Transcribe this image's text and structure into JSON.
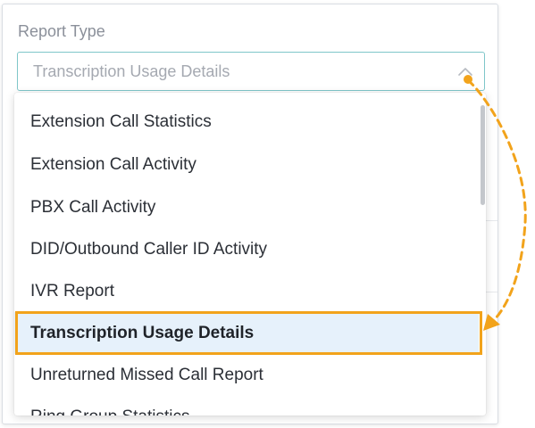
{
  "report_type": {
    "label": "Report Type",
    "selected_value": "Transcription Usage Details"
  },
  "dropdown": {
    "options": [
      {
        "label": "Extension Call Statistics",
        "selected": false
      },
      {
        "label": "Extension Call Activity",
        "selected": false
      },
      {
        "label": "PBX Call Activity",
        "selected": false
      },
      {
        "label": "DID/Outbound Caller ID Activity",
        "selected": false
      },
      {
        "label": "IVR Report",
        "selected": false
      },
      {
        "label": "Transcription Usage Details",
        "selected": true
      },
      {
        "label": "Unreturned Missed Call Report",
        "selected": false
      },
      {
        "label": "Ring Group Statistics",
        "selected": false
      }
    ]
  },
  "colors": {
    "accent_border": "#7fc6c9",
    "selected_background": "#e6f1fb",
    "annotation": "#f2a31b"
  },
  "icons": {
    "select_chevron": "chevron-up-icon"
  }
}
